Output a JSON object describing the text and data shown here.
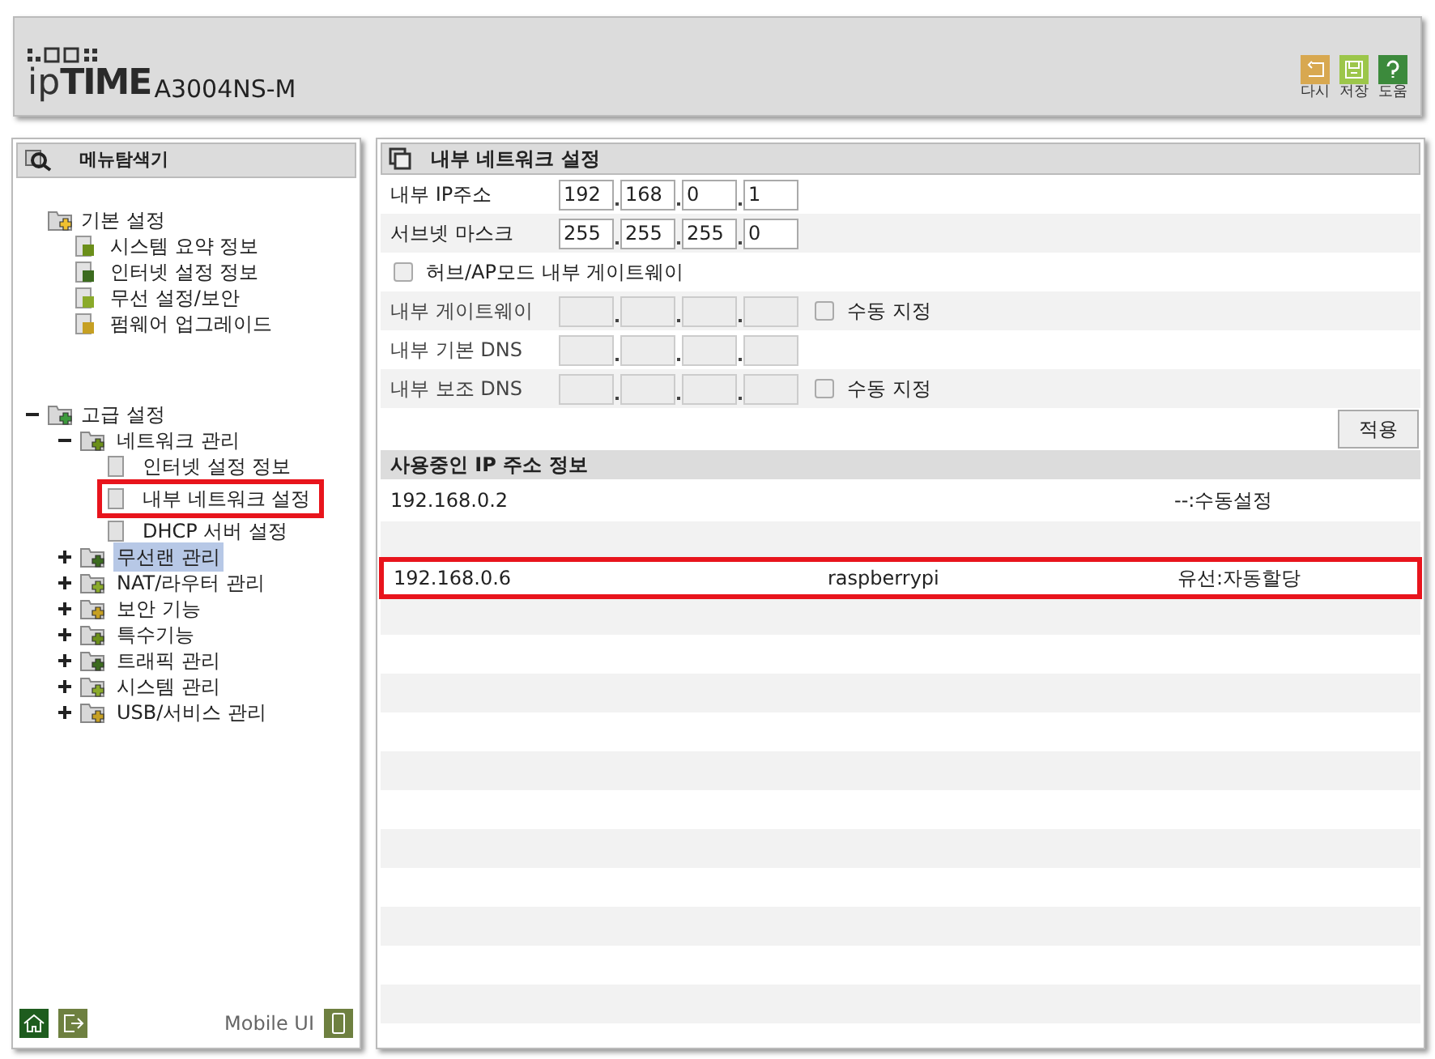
{
  "header": {
    "brand_prefix": "ip",
    "brand_main": "TIME",
    "model": "A3004NS-M",
    "actions": [
      {
        "label": "다시"
      },
      {
        "label": "저장"
      },
      {
        "label": "도움"
      }
    ]
  },
  "sidebar": {
    "title": "메뉴탐색기",
    "tree": [
      {
        "label": "기본 설정",
        "children": [
          {
            "label": "시스템 요약 정보",
            "selected": false
          },
          {
            "label": "인터넷 설정 정보",
            "selected": false
          },
          {
            "label": "무선 설정/보안",
            "selected": false
          },
          {
            "label": "펌웨어 업그레이드",
            "selected": false
          }
        ]
      },
      {
        "label": "고급 설정",
        "expanded": true,
        "children": [
          {
            "label": "네트워크 관리",
            "expanded": true,
            "selected": false,
            "children": [
              {
                "label": "인터넷 설정 정보",
                "selected": false,
                "highlighted": false
              },
              {
                "label": "내부 네트워크 설정",
                "selected": false,
                "highlighted": true
              },
              {
                "label": "DHCP 서버 설정",
                "selected": false,
                "highlighted": false
              }
            ]
          },
          {
            "label": "무선랜 관리",
            "expanded": false,
            "selected": true
          },
          {
            "label": "NAT/라우터 관리",
            "expanded": false,
            "selected": false
          },
          {
            "label": "보안 기능",
            "expanded": false,
            "selected": false
          },
          {
            "label": "특수기능",
            "expanded": false,
            "selected": false
          },
          {
            "label": "트래픽 관리",
            "expanded": false,
            "selected": false
          },
          {
            "label": "시스템 관리",
            "expanded": false,
            "selected": false
          },
          {
            "label": "USB/서비스 관리",
            "expanded": false,
            "selected": false
          }
        ]
      }
    ],
    "mobile_label": "Mobile UI"
  },
  "settings": {
    "title": "내부 네트워크 설정",
    "rows": [
      {
        "kind": "address",
        "label": "내부 IP주소",
        "octets": [
          "192",
          "168",
          "0",
          "1"
        ],
        "disabled": false
      },
      {
        "kind": "address",
        "label": "서브넷 마스크",
        "octets": [
          "255",
          "255",
          "255",
          "0"
        ],
        "disabled": false
      },
      {
        "kind": "checkbox",
        "label": "허브/AP모드 내부 게이트웨이",
        "checked": false
      },
      {
        "kind": "address",
        "label": "내부 게이트웨이",
        "disabled": true,
        "manual": {
          "label": "수동 지정",
          "checked": false
        }
      },
      {
        "kind": "address",
        "label": "내부 기본 DNS",
        "disabled": true
      },
      {
        "kind": "address",
        "label": "내부 보조 DNS",
        "disabled": true,
        "manual": {
          "label": "수동 지정",
          "checked": false
        }
      }
    ],
    "apply_button": "적용"
  },
  "ip_table": {
    "title": "사용중인 IP 주소 정보",
    "rows": [
      {
        "ip": "192.168.0.2",
        "type": "--:수동설정",
        "highlighted": false
      },
      {
        "ip": "192.168.0.6",
        "name": "raspberrypi",
        "type": "유선:자동할당",
        "highlighted": true
      }
    ]
  }
}
